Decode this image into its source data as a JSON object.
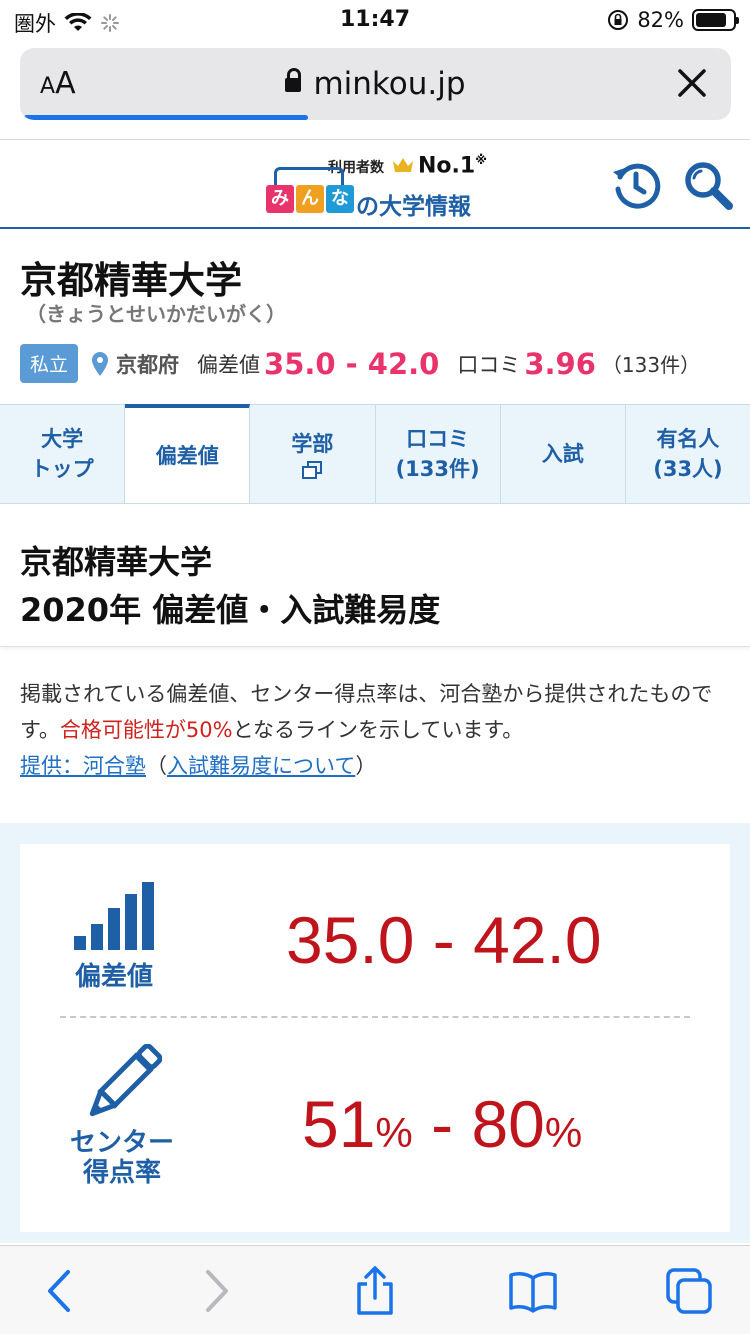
{
  "status": {
    "carrier": "圏外",
    "time": "11:47",
    "battery": "82%",
    "battery_level": 0.82
  },
  "browser": {
    "aa_small": "A",
    "aa_big": "A",
    "url": "minkou.jp",
    "load_progress": 0.4
  },
  "logo": {
    "top_text": "利用者数",
    "no1": "No.1",
    "mark": "※",
    "box": [
      "み",
      "ん",
      "な"
    ],
    "box_colors": [
      "#e8336b",
      "#f0a020",
      "#1f9ad6"
    ],
    "main": "の大学情報"
  },
  "university": {
    "name": "京都精華大学",
    "kana": "（きょうとせいかだいがく）",
    "type_badge": "私立",
    "prefecture": "京都府",
    "deviation_label": "偏差値",
    "deviation_value": "35.0 - 42.0",
    "review_label": "口コミ",
    "review_score": "3.96",
    "review_count": "（133件）"
  },
  "tabs": [
    {
      "line1": "大学",
      "line2": "トップ"
    },
    {
      "line1": "偏差値",
      "line2": ""
    },
    {
      "line1": "学部",
      "line2": ""
    },
    {
      "line1": "口コミ",
      "line2": "(133件)"
    },
    {
      "line1": "入試",
      "line2": ""
    },
    {
      "line1": "有名人",
      "line2": "(33人)"
    }
  ],
  "section": {
    "line1": "京都精華大学",
    "line2": "2020年 偏差値・入試難易度"
  },
  "description": {
    "text1": "掲載されている偏差値、センター得点率は、河合塾から提供されたものです。",
    "highlight": "合格可能性が50%",
    "text2": "となるラインを示しています。",
    "link1": "提供：河合塾",
    "paren_open": "（",
    "link2": "入試難易度について",
    "paren_close": "）"
  },
  "scores": {
    "deviation_label": "偏差値",
    "deviation_value": "35.0 - 42.0",
    "center_label_1": "センター",
    "center_label_2": "得点率",
    "center_low": "51",
    "center_high": "80",
    "pct": "%",
    "dash": " - "
  },
  "colors": {
    "brand_blue": "#1f5fa6",
    "accent_pink": "#e8336b",
    "score_red": "#c0141c",
    "tab_bg": "#eaf4fb",
    "ios_blue": "#1a73e8"
  }
}
